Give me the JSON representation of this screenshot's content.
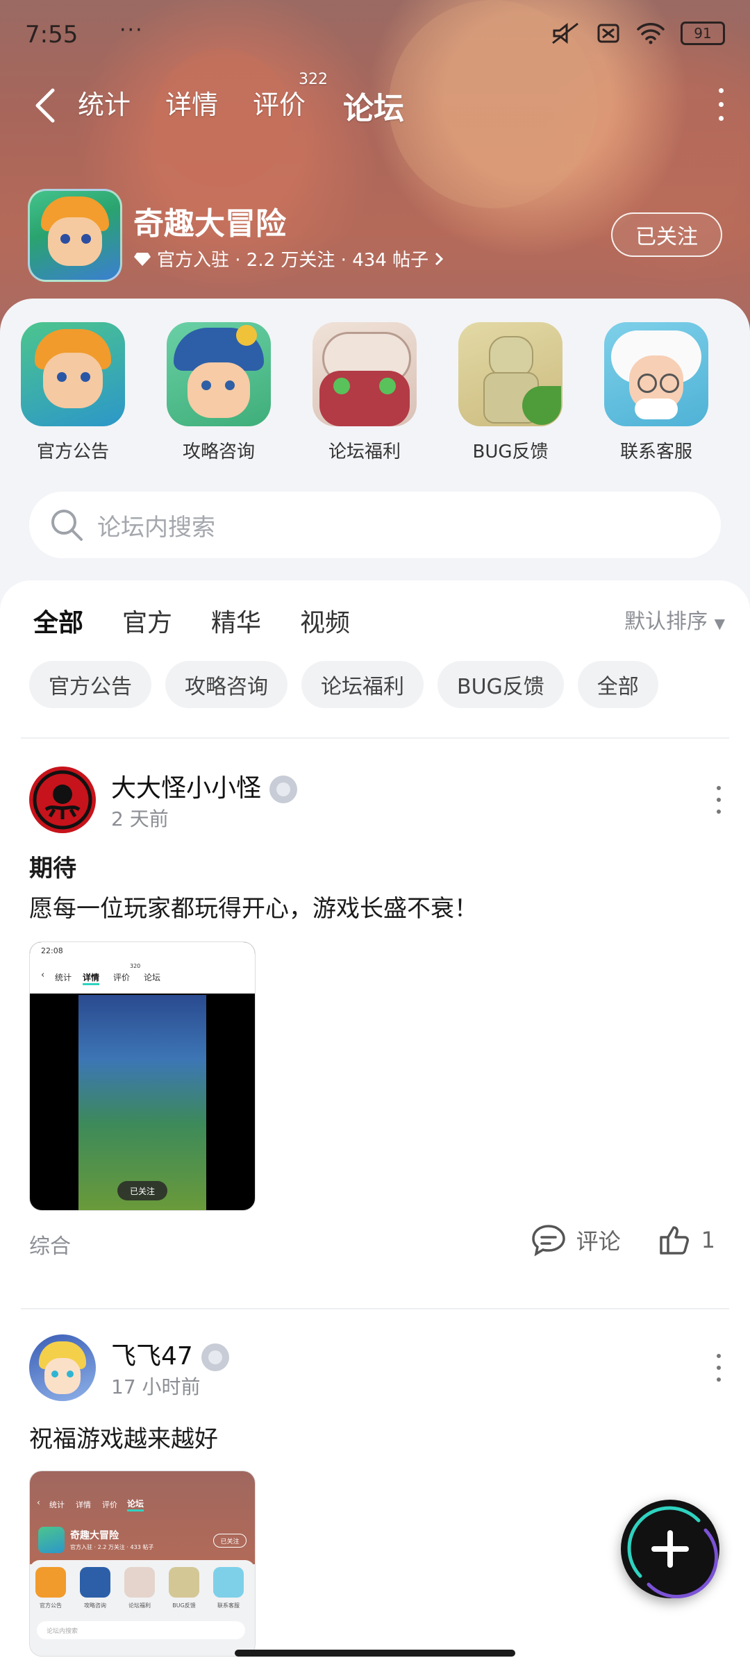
{
  "status": {
    "time": "7:55",
    "battery": "91"
  },
  "nav": {
    "tabs": [
      {
        "label": "统计"
      },
      {
        "label": "详情"
      },
      {
        "label": "评价",
        "badge": "322"
      },
      {
        "label": "论坛"
      }
    ]
  },
  "game": {
    "name": "奇趣大冒险",
    "meta": "官方入驻 · 2.2 万关注 · 434 帖子",
    "follow_label": "已关注"
  },
  "categories": [
    {
      "label": "官方公告",
      "icon": "hero-boy-icon"
    },
    {
      "label": "攻略咨询",
      "icon": "pirate-girl-icon"
    },
    {
      "label": "论坛福利",
      "icon": "skull-monster-icon"
    },
    {
      "label": "BUG反馈",
      "icon": "statue-icon"
    },
    {
      "label": "联系客服",
      "icon": "old-scientist-icon"
    }
  ],
  "search": {
    "placeholder": "论坛内搜索"
  },
  "filters": {
    "tabs": [
      "全部",
      "官方",
      "精华",
      "视频"
    ],
    "sort": "默认排序",
    "chips": [
      "官方公告",
      "攻略咨询",
      "论坛福利",
      "BUG反馈",
      "全部"
    ]
  },
  "posts": [
    {
      "user": "大大怪小小怪",
      "time": "2 天前",
      "title": "期待",
      "body": "愿每一位玩家都玩得开心，游戏长盛不衰！",
      "tag": "综合",
      "comment_label": "评论",
      "likes": "1",
      "thumb": {
        "time": "22:08",
        "tabs": [
          "统计",
          "详情",
          "评价",
          "论坛"
        ],
        "badge": "320",
        "follow": "已关注"
      }
    },
    {
      "user": "飞飞47",
      "time": "17 小时前",
      "body": "祝福游戏越来越好",
      "thumb": {
        "tabs": [
          "统计",
          "详情",
          "评价",
          "论坛"
        ],
        "game": "奇趣大冒险",
        "meta": "官方入驻 · 2.2 万关注 · 433 帖子",
        "follow": "已关注",
        "cats": [
          "官方公告",
          "攻略咨询",
          "论坛福利",
          "BUG反馈",
          "联系客服"
        ],
        "search": "论坛内搜索"
      }
    }
  ],
  "colors": {
    "accent": "#2fd3c0",
    "header": "#a8665b"
  }
}
